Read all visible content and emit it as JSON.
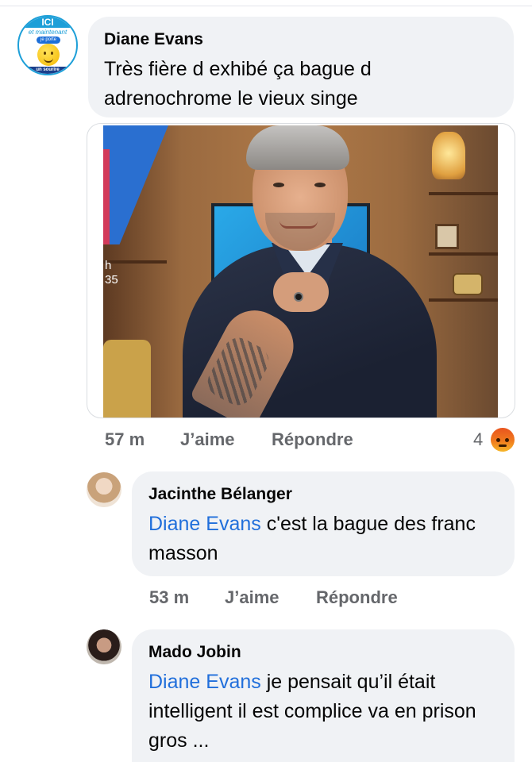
{
  "thread": {
    "main_comment": {
      "author": "Diane Evans",
      "text": "Très fière d exhibé ça bague d adrenochrome le vieux singe",
      "avatar": {
        "top_text": "ICI",
        "line2": "et maintenant",
        "pill": "je porte",
        "bottom_text": "un sourire",
        "icon": "smiley-emoji-icon"
      },
      "photo": {
        "caption_line1": "h",
        "caption_line2": "35"
      },
      "time": "57 m",
      "like_label": "J’aime",
      "reply_label": "Répondre",
      "reaction_count": "4",
      "reaction_icon": "angry-reaction-icon"
    },
    "replies": [
      {
        "author": "Jacinthe Bélanger",
        "mention": "Diane Evans",
        "text": " c'est la bague des franc masson",
        "time": "53 m",
        "like_label": "J’aime",
        "reply_label": "Répondre"
      },
      {
        "author": "Mado Jobin",
        "mention": "Diane Evans",
        "text": " je pensait qu’il était intelligent il est complice va en prison gros ..."
      }
    ]
  },
  "colors": {
    "bubble": "#f0f2f5",
    "mention": "#216fdb",
    "meta": "#65676b"
  }
}
